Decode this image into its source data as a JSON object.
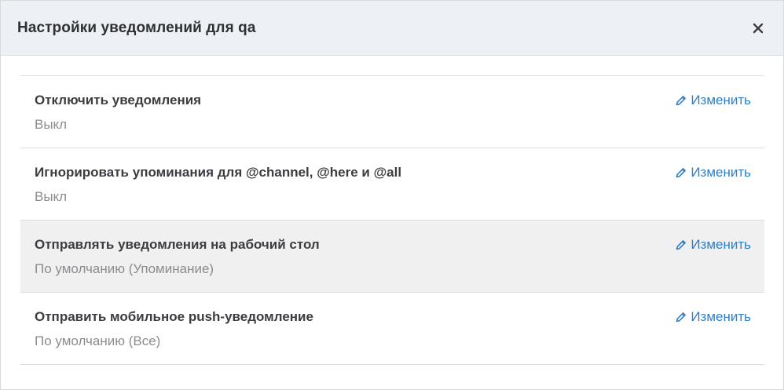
{
  "modal": {
    "title": "Настройки уведомлений для qa",
    "close_icon": "close-icon"
  },
  "settings": [
    {
      "title": "Отключить уведомления",
      "value": "Выкл",
      "edit_label": "Изменить",
      "active": false
    },
    {
      "title": "Игнорировать упоминания для @channel, @here и @all",
      "value": "Выкл",
      "edit_label": "Изменить",
      "active": false
    },
    {
      "title": "Отправлять уведомления на рабочий стол",
      "value": "По умолчанию (Упоминание)",
      "edit_label": "Изменить",
      "active": true
    },
    {
      "title": "Отправить мобильное push-уведомление",
      "value": "По умолчанию (Все)",
      "edit_label": "Изменить",
      "active": false
    }
  ],
  "colors": {
    "header_bg": "#edf1f5",
    "link": "#2d81cb",
    "active_row_bg": "#f0f0f0"
  }
}
